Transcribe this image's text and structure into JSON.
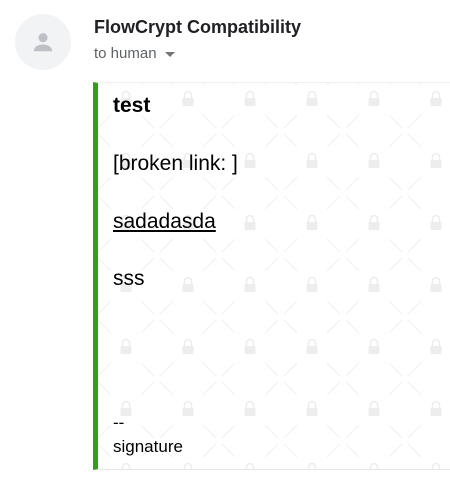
{
  "header": {
    "sender_name": "FlowCrypt Compatibility",
    "recipient_text": "to human",
    "avatar_icon": "person-icon",
    "dropdown_icon": "caret-down-icon"
  },
  "message": {
    "accent_color": "#31a217",
    "background_pattern_icon": "lock-icon",
    "subject": "test",
    "broken_link_text": "[broken link: ]",
    "link_text": "sadadasda",
    "body_text": "sss",
    "signature_dash": "--",
    "signature_text": "signature"
  }
}
